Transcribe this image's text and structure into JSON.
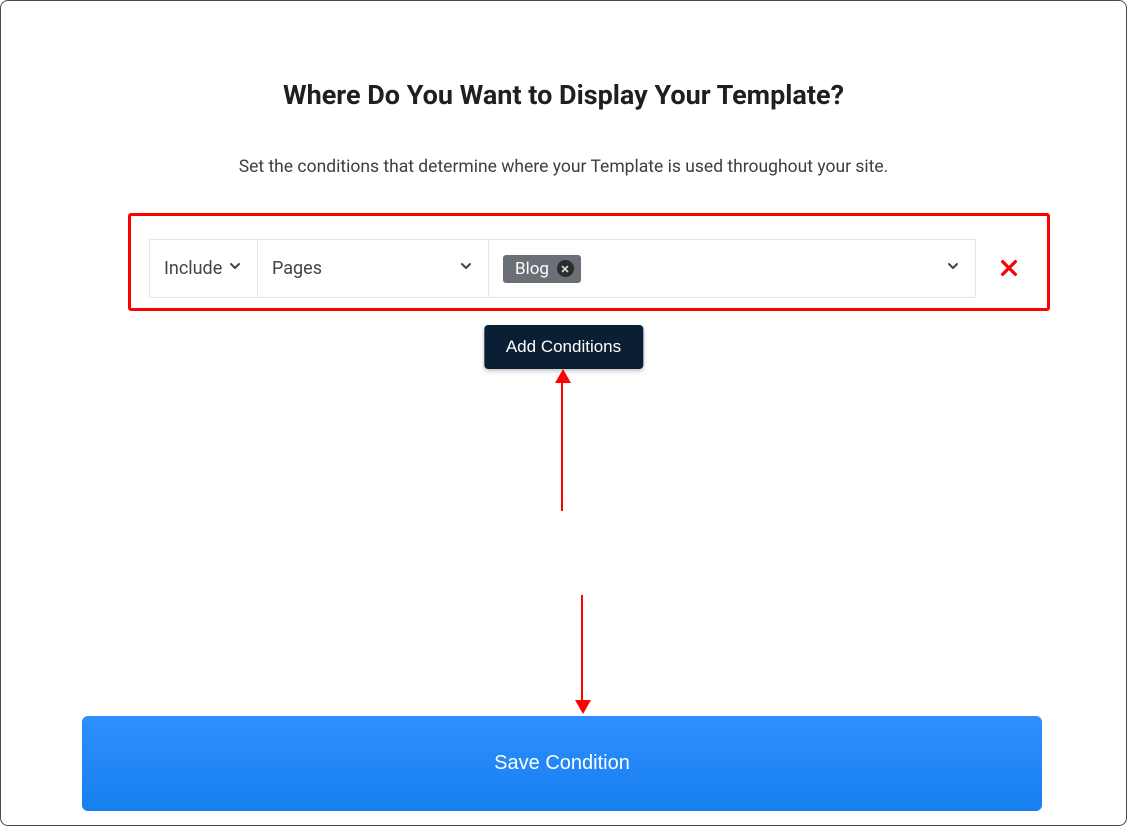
{
  "header": {
    "title": "Where Do You Want to Display Your Template?",
    "subtitle": "Set the conditions that determine where your Template is used throughout your site."
  },
  "condition": {
    "mode": "Include",
    "scope": "Pages",
    "tag": "Blog"
  },
  "buttons": {
    "add_conditions": "Add Conditions",
    "save_condition": "Save Condition"
  }
}
